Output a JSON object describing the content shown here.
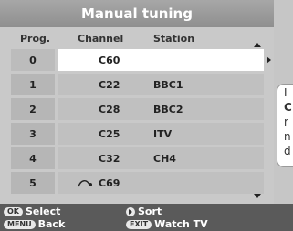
{
  "title": "Manual tuning",
  "columns": {
    "prog": "Prog.",
    "channel": "Channel",
    "station": "Station"
  },
  "rows": [
    {
      "prog": "0",
      "channel": "C60",
      "station": ""
    },
    {
      "prog": "1",
      "channel": "C22",
      "station": "BBC1"
    },
    {
      "prog": "2",
      "channel": "C28",
      "station": "BBC2"
    },
    {
      "prog": "3",
      "channel": "C25",
      "station": "ITV"
    },
    {
      "prog": "4",
      "channel": "C32",
      "station": "CH4"
    },
    {
      "prog": "5",
      "channel": "C69",
      "station": "",
      "signal_icon": "signal-wave-icon"
    }
  ],
  "side_panel": {
    "letters": [
      "I",
      "C",
      "r",
      "n",
      "d"
    ]
  },
  "footer": {
    "ok_key": "OK",
    "ok_label": "Select",
    "menu_key": "MENU",
    "menu_label": "Back",
    "sort_label": "Sort",
    "exit_key": "EXIT",
    "exit_label": "Watch TV"
  },
  "colors": {
    "title_bar": "#999999",
    "panel": "#c9c9c9",
    "selected_row": "#ffffff",
    "footer": "#5a5a5a"
  }
}
